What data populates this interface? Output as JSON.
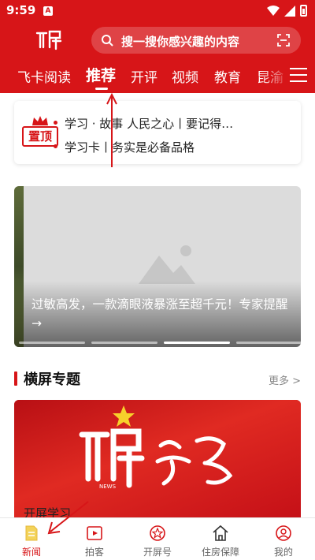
{
  "status_bar": {
    "time": "9:59",
    "notification_badge": "A"
  },
  "search": {
    "placeholder": "搜一搜你感兴趣的内容"
  },
  "tabs": [
    {
      "label": "飞卡阅读",
      "active": false
    },
    {
      "label": "推荐",
      "active": true
    },
    {
      "label": "开评",
      "active": false
    },
    {
      "label": "视频",
      "active": false
    },
    {
      "label": "教育",
      "active": false
    },
    {
      "label": "昆渝",
      "active": false
    }
  ],
  "pinned": {
    "badge": "置顶",
    "items": [
      "学习 · 故事  人民之心丨要记得…",
      "学习卡丨务实是必备品格"
    ]
  },
  "banner": {
    "caption": "过敏高发，一款滴眼液暴涨至超千元！专家提醒→",
    "slide_count": 4,
    "active_slide": 3
  },
  "section": {
    "title": "横屏专题",
    "more": "更多 >"
  },
  "feature_card": {
    "title": "开屏学习",
    "brand_small": "NEWS"
  },
  "bottom_nav": [
    {
      "label": "新闻",
      "icon": "news-icon",
      "active": true
    },
    {
      "label": "拍客",
      "icon": "video-icon",
      "active": false
    },
    {
      "label": "开屏号",
      "icon": "star-badge-icon",
      "active": false
    },
    {
      "label": "住房保障",
      "icon": "house-icon",
      "active": false
    },
    {
      "label": "我的",
      "icon": "profile-icon",
      "active": false
    }
  ],
  "colors": {
    "brand": "#d71518",
    "text": "#222222",
    "muted": "#888888"
  }
}
